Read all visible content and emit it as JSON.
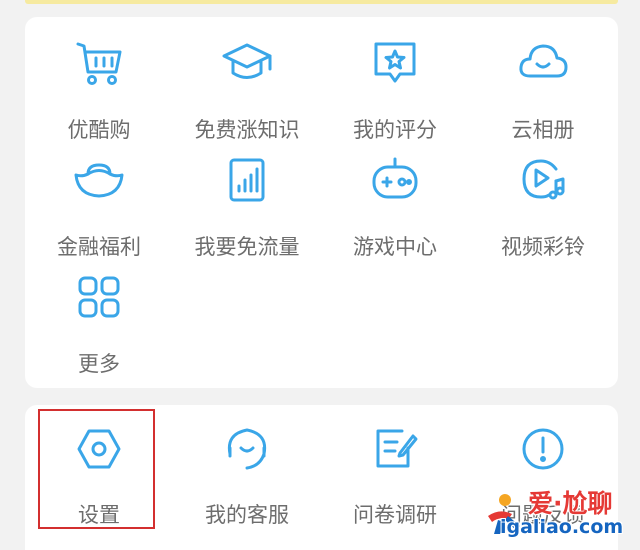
{
  "accent_color": "#3aa6e8",
  "highlight_color": "#d32f2f",
  "services": [
    {
      "label": "优酷购",
      "icon": "shopping-cart-icon"
    },
    {
      "label": "免费涨知识",
      "icon": "graduation-cap-icon"
    },
    {
      "label": "我的评分",
      "icon": "star-rating-icon"
    },
    {
      "label": "云相册",
      "icon": "cloud-icon"
    },
    {
      "label": "金融福利",
      "icon": "gold-ingot-icon"
    },
    {
      "label": "我要免流量",
      "icon": "data-bars-icon"
    },
    {
      "label": "游戏中心",
      "icon": "gamepad-icon"
    },
    {
      "label": "视频彩铃",
      "icon": "music-play-icon"
    },
    {
      "label": "更多",
      "icon": "grid-icon"
    }
  ],
  "tools": [
    {
      "label": "设置",
      "icon": "settings-hexagon-icon",
      "highlighted": true
    },
    {
      "label": "我的客服",
      "icon": "headset-icon"
    },
    {
      "label": "问卷调研",
      "icon": "survey-edit-icon"
    },
    {
      "label": "问题反馈",
      "icon": "exclamation-circle-icon"
    }
  ],
  "watermark": {
    "text": "爱·尬聊",
    "url": "igaliao.com"
  }
}
